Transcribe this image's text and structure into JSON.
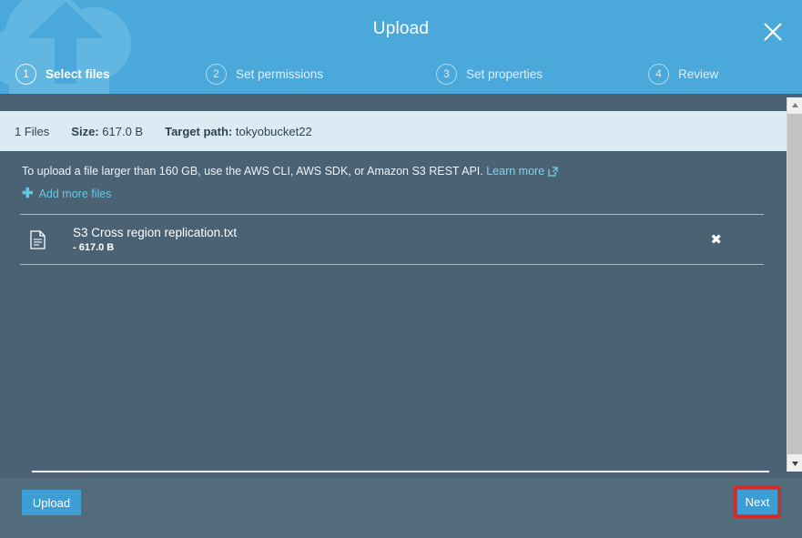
{
  "header": {
    "title": "Upload",
    "close_label": "close-icon",
    "watermark": "cloud-upload-watermark",
    "steps": [
      {
        "number": "1",
        "label": "Select files",
        "state": "active"
      },
      {
        "number": "2",
        "label": "Set permissions",
        "state": "inactive"
      },
      {
        "number": "3",
        "label": "Set properties",
        "state": "inactive"
      },
      {
        "number": "4",
        "label": "Review",
        "state": "inactive"
      }
    ]
  },
  "infobar": {
    "file_count": "1 Files",
    "size_label": "Size:",
    "size_value": "617.0 B",
    "target_label": "Target path:",
    "target_value": "tokyobucket22"
  },
  "content": {
    "hint_text": "To upload a file larger than 160 GB, use the AWS CLI, AWS SDK, or Amazon S3 REST API.",
    "hint_link": "Learn more",
    "add_more_label": "Add more files",
    "files": [
      {
        "name": "S3 Cross region replication.txt",
        "size": "- 617.0 B",
        "remove_label": "✖"
      }
    ]
  },
  "footer": {
    "upload_label": "Upload",
    "next_label": "Next"
  },
  "colors": {
    "header_blue": "#4aa8da",
    "body_slate": "#4a6274",
    "footer_slate": "#526b7d",
    "infobar_light": "#dceaf4",
    "button_blue": "#3d9ed6",
    "link_blue": "#63c7e4",
    "highlight_red": "#d12b2b"
  }
}
